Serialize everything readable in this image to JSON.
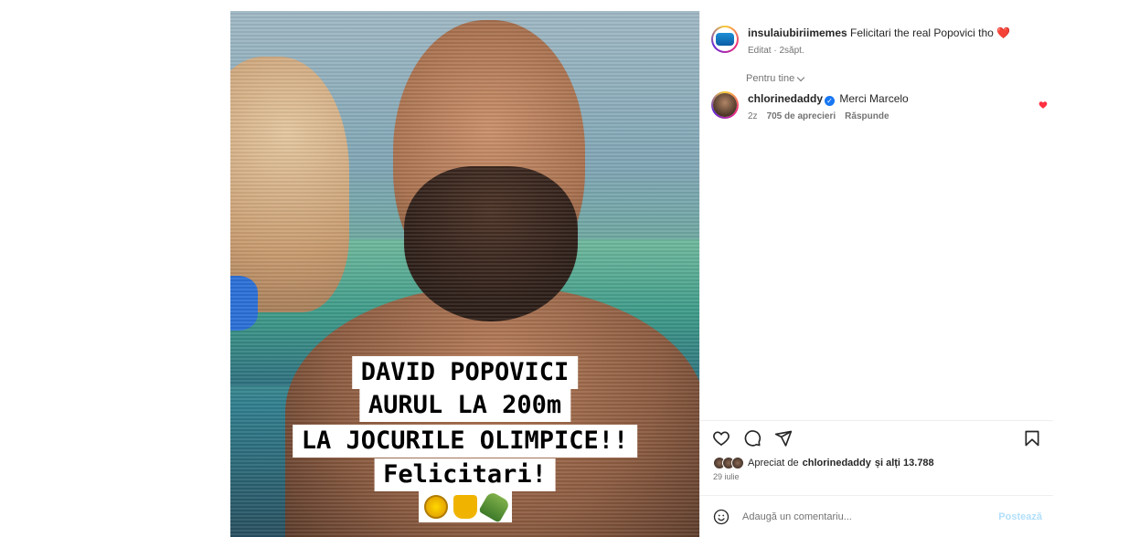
{
  "post": {
    "image": {
      "caption_lines": [
        "DAVID POPOVICI",
        "AURUL LA 200m",
        "LA JOCURILE OLIMPICE!!",
        "Felicitari!"
      ],
      "emojis": [
        "sports-medal",
        "trophy",
        "champagne"
      ]
    },
    "header": {
      "username": "insulaiubiriimemes",
      "caption": "Felicitari the real Popovici tho",
      "caption_emoji": "❤️",
      "edited_label": "Editat",
      "time": "2săpt."
    },
    "sort_label": "Pentru tine",
    "comments": [
      {
        "username": "chlorinedaddy",
        "verified": true,
        "text": "Merci Marcelo",
        "time": "2z",
        "likes": "705 de aprecieri",
        "reply_label": "Răspunde"
      }
    ],
    "likes": {
      "prefix": "Apreciat de",
      "by": "chlorinedaddy",
      "suffix": "și alți 13.788"
    },
    "date": "29 iulie",
    "comment_box": {
      "placeholder": "Adaugă un comentariu...",
      "post_label": "Postează"
    }
  },
  "colors": {
    "accent_blue": "#0095f6",
    "like_red": "#ff3040",
    "muted_text": "#737373"
  },
  "icons": [
    "heart-icon",
    "comment-icon",
    "share-icon",
    "bookmark-icon",
    "emoji-icon",
    "verified-badge-icon"
  ]
}
